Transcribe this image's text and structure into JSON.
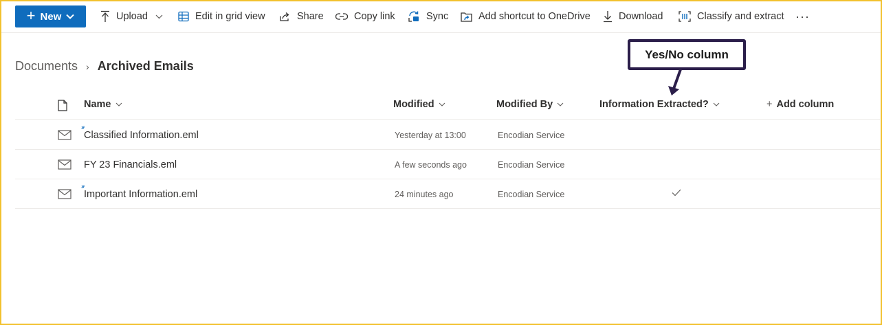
{
  "toolbar": {
    "new_label": "New",
    "upload_label": "Upload",
    "grid_label": "Edit in grid view",
    "share_label": "Share",
    "copy_link_label": "Copy link",
    "sync_label": "Sync",
    "shortcut_label": "Add shortcut to OneDrive",
    "download_label": "Download",
    "classify_label": "Classify and extract",
    "more_label": "···"
  },
  "breadcrumb": {
    "root": "Documents",
    "separator": "›",
    "current": "Archived Emails"
  },
  "callout": {
    "text": "Yes/No column"
  },
  "columns": {
    "name": "Name",
    "modified": "Modified",
    "modified_by": "Modified By",
    "info_extracted": "Information Extracted?",
    "add_column": "Add column"
  },
  "rows": [
    {
      "name": "Classified Information.eml",
      "modified": "Yesterday at 13:00",
      "modified_by": "Encodian Service",
      "info_extracted": false
    },
    {
      "name": "FY 23 Financials.eml",
      "modified": "A few seconds ago",
      "modified_by": "Encodian Service",
      "info_extracted": false
    },
    {
      "name": "Important Information.eml",
      "modified": "24 minutes ago",
      "modified_by": "Encodian Service",
      "info_extracted": true
    }
  ],
  "colors": {
    "accent": "#0f6cbd",
    "frame": "#f2c12e",
    "callout_border": "#2b1e4a"
  }
}
